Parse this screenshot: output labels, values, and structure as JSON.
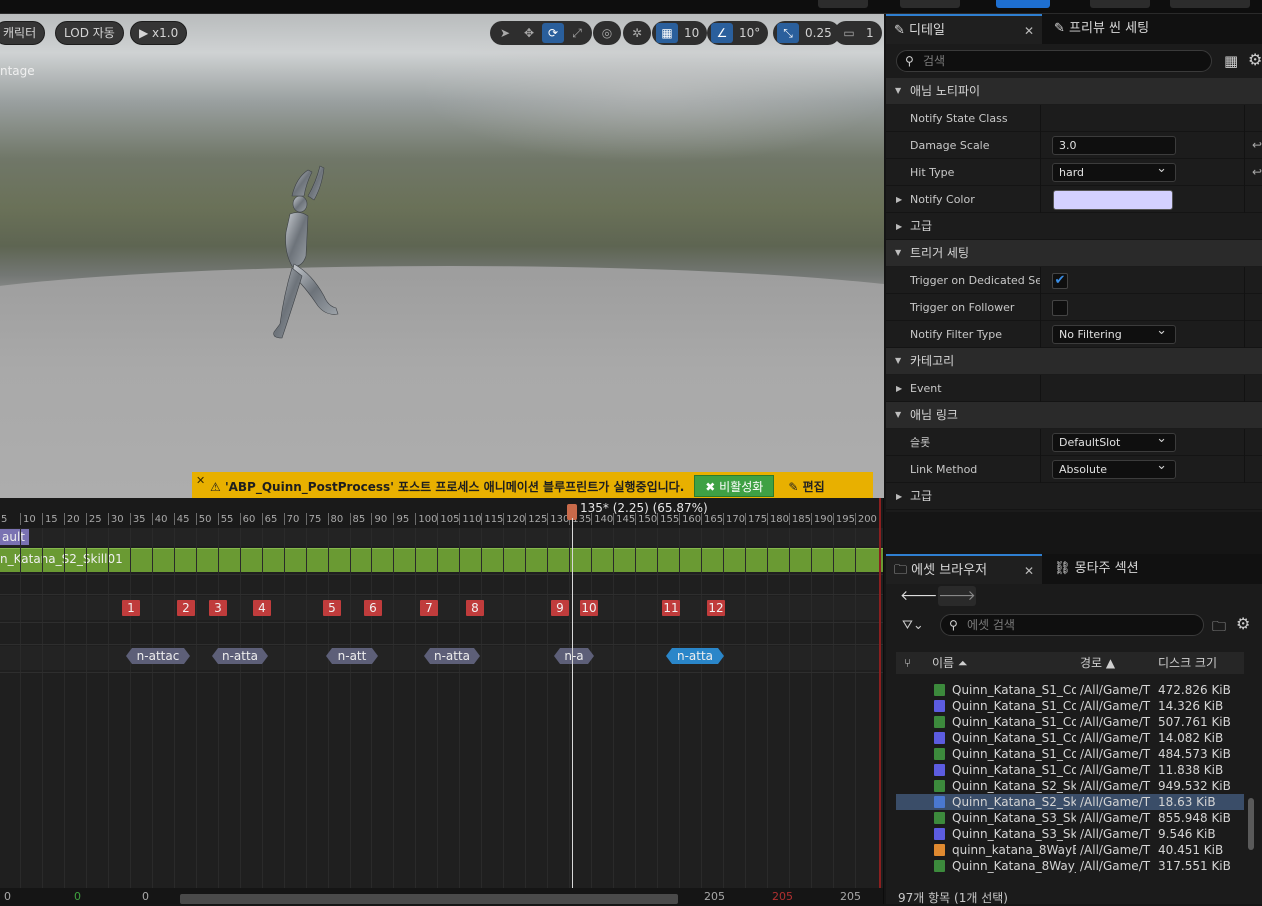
{
  "viewport": {
    "buttons": {
      "character": "캐릭터",
      "lod": "LOD 자동",
      "speed": "x1.0"
    },
    "label": "ntage",
    "toolbar": {
      "grid_value": "10",
      "angle_value": "10°",
      "scale_value": "0.25",
      "camera_value": "1"
    }
  },
  "banner": {
    "message": "'ABP_Quinn_PostProcess' 포스트 프로세스 애니메이션 블루프린트가 실행중입니다.",
    "disable_label": "비활성화",
    "edit_label": "편집"
  },
  "timeline": {
    "ticks": [
      "5",
      "10",
      "15",
      "20",
      "25",
      "30",
      "35",
      "40",
      "45",
      "50",
      "55",
      "60",
      "65",
      "70",
      "75",
      "80",
      "85",
      "90",
      "95",
      "100",
      "105",
      "110",
      "115",
      "120",
      "125",
      "130",
      "135",
      "140",
      "145",
      "150",
      "155",
      "160",
      "165",
      "170",
      "175",
      "180",
      "185",
      "190",
      "195",
      "200"
    ],
    "playhead_label": "135* (2.25) (65.87%)",
    "slot_label": "ault",
    "segment_label": "n_Katana_S2_Skill01",
    "notifies": [
      "1",
      "2",
      "3",
      "4",
      "5",
      "6",
      "7",
      "8",
      "9",
      "10",
      "11",
      "12"
    ],
    "states": [
      "n-attac",
      "n-atta",
      "n-att",
      "n-atta",
      "n-a",
      "n-atta"
    ],
    "bottom_numbers": [
      "0",
      "0",
      "0",
      "205",
      "205",
      "205"
    ]
  },
  "details": {
    "tabs": {
      "details": "디테일",
      "preview": "프리뷰 씬 세팅"
    },
    "search_placeholder": "검색",
    "sections": {
      "anim_notify": "애님 노티파이",
      "advanced1": "고급",
      "trigger": "트리거 세팅",
      "category": "카테고리",
      "anim_link": "애님 링크",
      "advanced2": "고급"
    },
    "props": {
      "notify_state_class": "Notify State Class",
      "damage_scale": "Damage Scale",
      "damage_scale_value": "3.0",
      "hit_type": "Hit Type",
      "hit_type_value": "hard",
      "notify_color": "Notify Color",
      "notify_color_value": "#d4d1ff",
      "trigger_dedicated": "Trigger on Dedicated Se...",
      "trigger_follower": "Trigger on Follower",
      "notify_filter": "Notify Filter Type",
      "notify_filter_value": "No Filtering",
      "event": "Event",
      "slot": "슬롯",
      "slot_value": "DefaultSlot",
      "link_method": "Link Method",
      "link_method_value": "Absolute"
    }
  },
  "assets": {
    "tabs": {
      "browser": "에셋 브라우저",
      "montage": "몽타주 섹션"
    },
    "search_placeholder": "에셋 검색",
    "headers": {
      "name": "이름",
      "path": "경로",
      "size": "디스크 크기"
    },
    "rows": [
      {
        "name": "Quinn_Katana_S1_Co",
        "path": "/All/Game/T",
        "size": "472.826 KiB",
        "icon": "#3c8a3c"
      },
      {
        "name": "Quinn_Katana_S1_Co",
        "path": "/All/Game/T",
        "size": "14.326 KiB",
        "icon": "#5c5ce0"
      },
      {
        "name": "Quinn_Katana_S1_Co",
        "path": "/All/Game/T",
        "size": "507.761 KiB",
        "icon": "#3c8a3c"
      },
      {
        "name": "Quinn_Katana_S1_Co",
        "path": "/All/Game/T",
        "size": "14.082 KiB",
        "icon": "#5c5ce0"
      },
      {
        "name": "Quinn_Katana_S1_Co",
        "path": "/All/Game/T",
        "size": "484.573 KiB",
        "icon": "#3c8a3c"
      },
      {
        "name": "Quinn_Katana_S1_Co",
        "path": "/All/Game/T",
        "size": "11.838 KiB",
        "icon": "#5c5ce0"
      },
      {
        "name": "Quinn_Katana_S2_Ski",
        "path": "/All/Game/T",
        "size": "949.532 KiB",
        "icon": "#3c8a3c"
      },
      {
        "name": "Quinn_Katana_S2_Ski",
        "path": "/All/Game/T",
        "size": "18.63 KiB",
        "icon": "#4a78d0"
      },
      {
        "name": "Quinn_Katana_S3_Ski",
        "path": "/All/Game/T",
        "size": "855.948 KiB",
        "icon": "#3c8a3c"
      },
      {
        "name": "Quinn_Katana_S3_Ski",
        "path": "/All/Game/T",
        "size": "9.546 KiB",
        "icon": "#5c5ce0"
      },
      {
        "name": "quinn_katana_8WayB",
        "path": "/All/Game/T",
        "size": "40.451 KiB",
        "icon": "#e08a30"
      },
      {
        "name": "Quinn_Katana_8Way_",
        "path": "/All/Game/T",
        "size": "317.551 KiB",
        "icon": "#3c8a3c"
      }
    ],
    "footer": "97개 항목 (1개 선택)"
  }
}
